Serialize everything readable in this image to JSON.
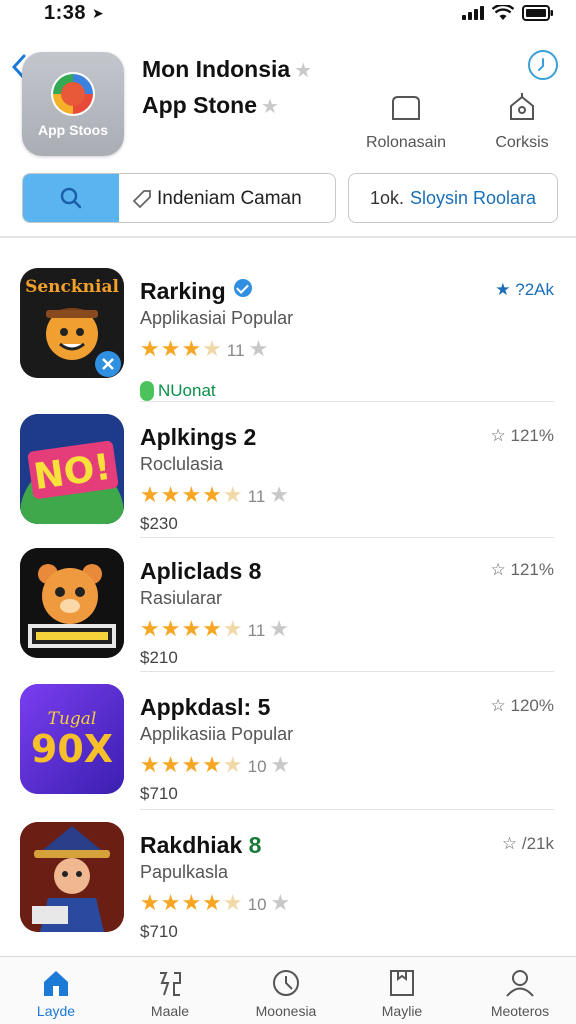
{
  "status": {
    "time": "1:38"
  },
  "header": {
    "title_line1": "Mon Indonsia",
    "title_line2": "App Stone",
    "logo_label": "App Stoos",
    "actions": [
      {
        "label": "Rolonasain",
        "icon": "bag-icon"
      },
      {
        "label": "Corksis",
        "icon": "house-icon"
      }
    ]
  },
  "search": {
    "value": "Indeniam Caman",
    "suggest_prefix": "1ok.",
    "suggest_text": "Sloysin Roolara"
  },
  "apps": [
    {
      "name": "Rarking",
      "subtitle": "Applikasiai Popular",
      "rating_count": "11",
      "rank": "★ ?2Ak",
      "badge": "NUonat",
      "price": ""
    },
    {
      "name": "Aplkings 2",
      "subtitle": "Roclulasia",
      "rating_count": "11",
      "rank": "☆ 121%",
      "price": "$230"
    },
    {
      "name": "Apliclads 8",
      "subtitle": "Rasiularar",
      "rating_count": "11",
      "rank": "☆ 121%",
      "price": "$210"
    },
    {
      "name": "Appkdasl: 5",
      "subtitle": "Applikasiia Popular",
      "rating_count": "10",
      "rank": "☆ 120%",
      "price": "$710"
    },
    {
      "name": "Rakdhiak",
      "name_num": "8",
      "subtitle": "Papulkasla",
      "rating_count": "10",
      "rank": "☆ /21k",
      "price": "$710"
    }
  ],
  "tabs": [
    {
      "label": "Layde",
      "icon": "home-icon",
      "active": true
    },
    {
      "label": "Maale",
      "icon": "games-icon"
    },
    {
      "label": "Moonesia",
      "icon": "clock-icon"
    },
    {
      "label": "Maylie",
      "icon": "apps-icon"
    },
    {
      "label": "Meoteros",
      "icon": "profile-icon"
    }
  ],
  "colors": {
    "accent": "#1a7ad6",
    "search_button": "#5ab4f0",
    "star": "#f5a623",
    "badge_green": "#4bc35a"
  }
}
